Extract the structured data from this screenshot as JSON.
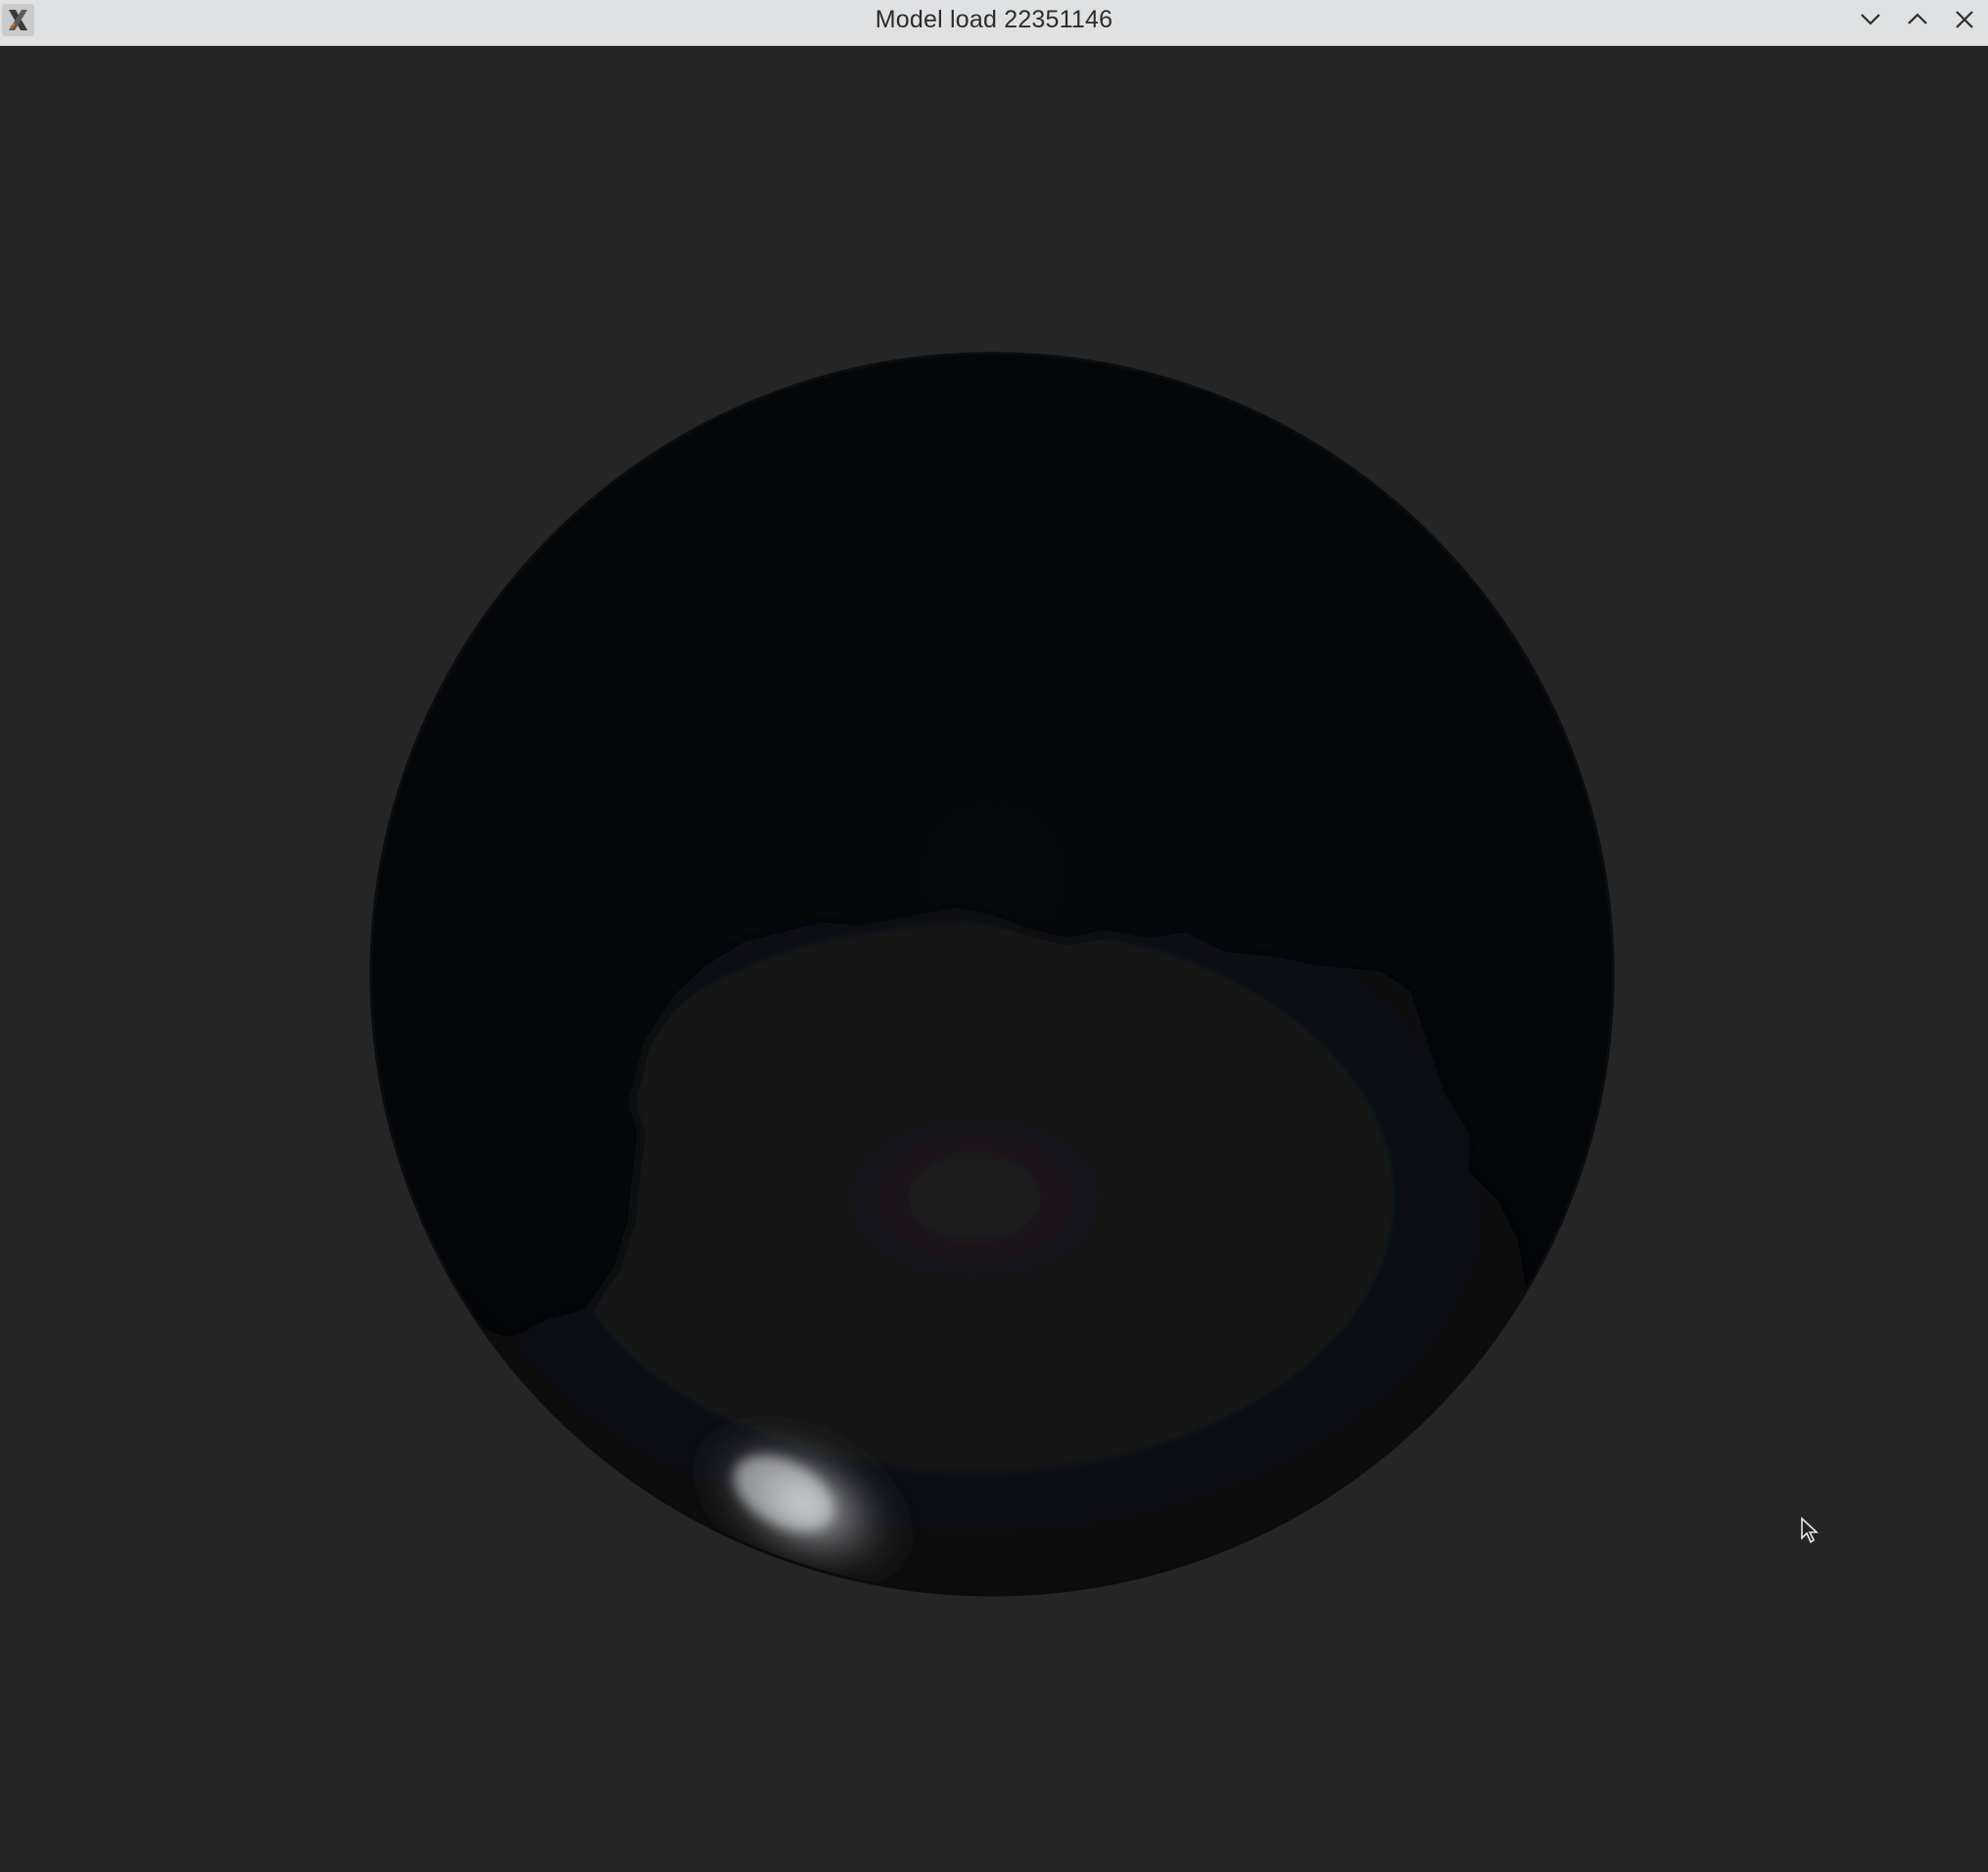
{
  "window": {
    "title": "Model load 22351146",
    "app_icon": "x-window-icon",
    "controls": [
      {
        "name": "minimize-button",
        "icon": "chevron-down-icon"
      },
      {
        "name": "maximize-button",
        "icon": "chevron-up-icon"
      },
      {
        "name": "close-button",
        "icon": "close-icon"
      }
    ]
  },
  "viewport": {
    "background_color": "#252525",
    "model": {
      "shape": "sphere",
      "base_color": "#05080b",
      "specular_color": "#e4e6e8"
    }
  },
  "cursor": {
    "icon": "mouse-pointer-icon"
  }
}
